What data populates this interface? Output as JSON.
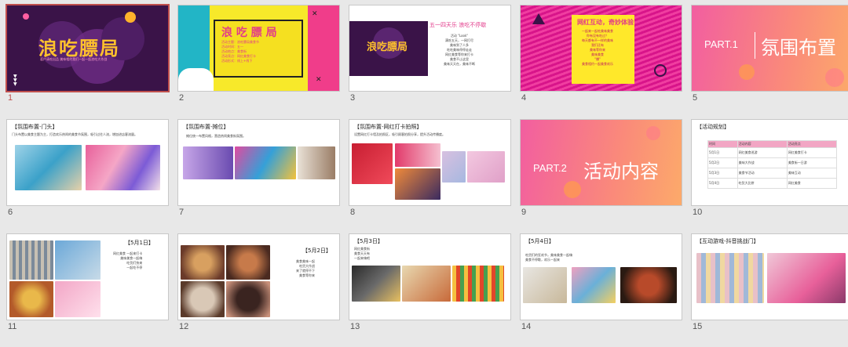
{
  "slides": [
    {
      "number": "1",
      "title": "浪吃膘局",
      "subtitle": "葛户清吃出品  美味相约我们一起一起浪吃大作战"
    },
    {
      "number": "2",
      "title": "浪 吃 膘 局"
    },
    {
      "number": "3",
      "title": "浪吃膘局",
      "heading": "五一四天乐 浪吃不停歇",
      "lines": [
        "活动 \"Look\"",
        "满吃五天，一网打尽",
        "美味到了人多",
        "吃吃美味停停走走",
        "网红美食等你来打卡",
        "美食不止这里",
        "美味天天在，美味不断"
      ]
    },
    {
      "number": "4",
      "heading": "网红互动，奇妙体验",
      "lines": [
        "一起来一起吃美味美食",
        "你有没有吃过？",
        "每天都有不一样的美味",
        "我们还有",
        "美味等你来",
        "美味美食",
        "\"爆\"",
        "美食相约一起美食欢乐"
      ]
    },
    {
      "number": "5",
      "part": "PART.1",
      "title": "氛围布置"
    },
    {
      "number": "6",
      "title": "【氛围布置-门头】",
      "desc": "门头布置以美食主题为主，打造欢乐热闹的美食节氛围，吸引过往人流，增加进店客流量。"
    },
    {
      "number": "7",
      "title": "【氛围布置-摊位】",
      "desc": "摊位统一布置风格，营造热闹美食街氛围。"
    },
    {
      "number": "8",
      "title": "【氛围布置-网红打卡拍照】",
      "desc": "设置网红打卡墙及拍照区，吸引顾客拍照分享，提升活动传播度。"
    },
    {
      "number": "9",
      "part": "PART.2",
      "title": "活动内容"
    },
    {
      "number": "10",
      "title": "【活动规划】",
      "table_headers": [
        "时间",
        "活动内容",
        "活动亮点"
      ],
      "table_rows": [
        [
          "5月1日",
          "网红美食巡游",
          "网红美食打卡"
        ],
        [
          "5月2日",
          "美味大作战",
          "美食街一日游"
        ],
        [
          "5月3日",
          "美食节活动",
          "美味互动"
        ],
        [
          "5月4日",
          "吃货大比拼",
          "网红美食"
        ]
      ]
    },
    {
      "number": "11",
      "title": "【5月1日】",
      "lines": [
        "网红美食 一起来打卡",
        "美味美食一起嗨",
        "吃货们快来",
        "一起吃不停"
      ]
    },
    {
      "number": "12",
      "title": "【5月2日】",
      "lines": [
        "美食美味一起",
        "吃货大作战",
        "来了就停不下",
        "美食等你来"
      ]
    },
    {
      "number": "13",
      "title": "【5月3日】",
      "lines": [
        "网红美食街",
        "美食天天有",
        "一起来嗨吧"
      ]
    },
    {
      "number": "14",
      "title": "【5月4日】",
      "lines": [
        "吃货们的狂欢节，美味美食一起嗨",
        "美食不停歇，欢乐一起来"
      ]
    },
    {
      "number": "15",
      "title": "【互动游戏-抖音挑战门】"
    }
  ],
  "colors": {
    "selected": "#c0504d",
    "panel": "#e8e8e8"
  }
}
